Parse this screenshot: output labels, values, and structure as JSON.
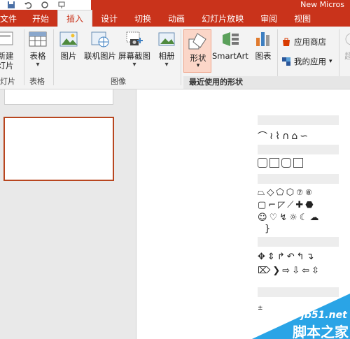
{
  "window": {
    "title": "New Micros"
  },
  "tabs": [
    {
      "label": "文件"
    },
    {
      "label": "开始"
    },
    {
      "label": "插入"
    },
    {
      "label": "设计"
    },
    {
      "label": "切换"
    },
    {
      "label": "动画"
    },
    {
      "label": "幻灯片放映"
    },
    {
      "label": "审阅"
    },
    {
      "label": "视图"
    }
  ],
  "ribbon": {
    "new_slide": {
      "line1": "新建",
      "line2": "灯片"
    },
    "table": {
      "label": "表格"
    },
    "picture": {
      "label": "图片"
    },
    "online_picture": {
      "label": "联机图片"
    },
    "screenshot": {
      "label": "屏幕截图"
    },
    "album": {
      "label": "相册"
    },
    "shapes": {
      "label": "形状"
    },
    "smartart": {
      "label": "SmartArt"
    },
    "chart": {
      "label": "图表"
    },
    "app_store": {
      "label": "应用商店"
    },
    "my_apps": {
      "label": "我的应用"
    },
    "extra": {
      "label": "超"
    },
    "groups": {
      "slides": "灯片",
      "tables": "表格",
      "images": "图像"
    }
  },
  "shapes_menu": {
    "recent_label": "最近使用的形状"
  },
  "watermark": {
    "url": "jb51.net",
    "name": "脚本之家"
  },
  "colors": {
    "accent": "#c9331b",
    "slide_border": "#b8461f",
    "watermark": "#2aa4e6"
  }
}
